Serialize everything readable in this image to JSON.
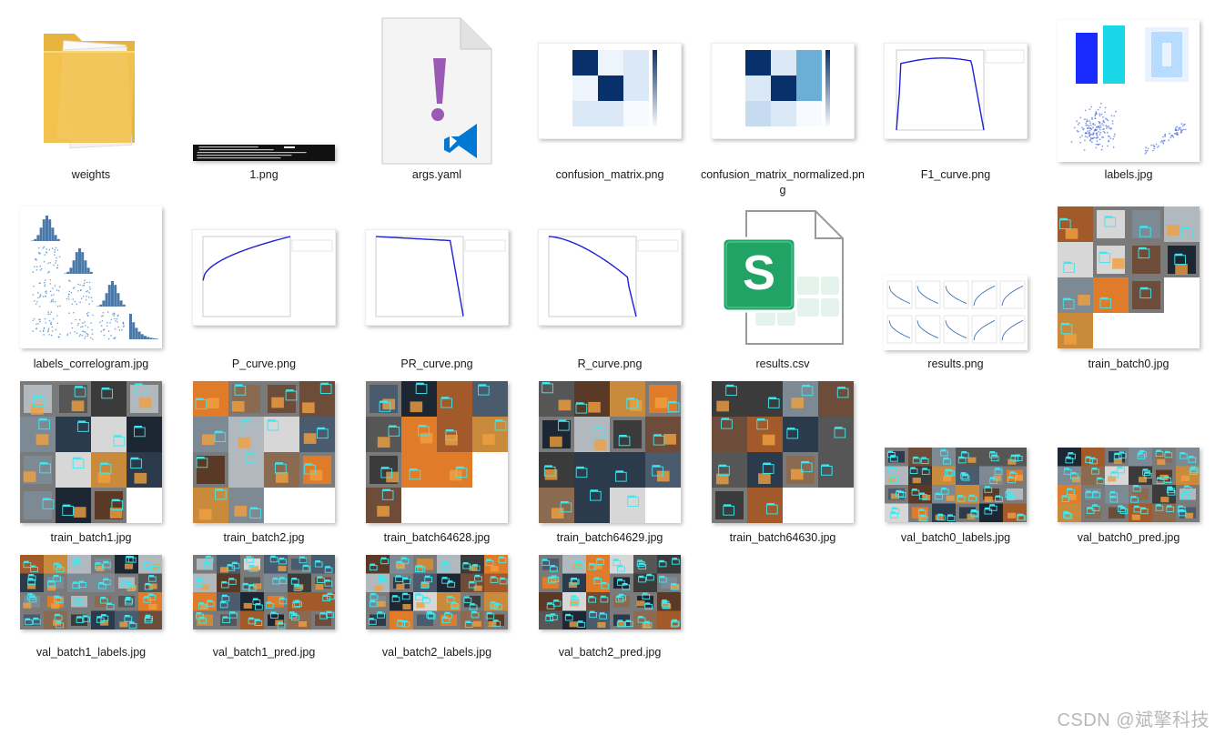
{
  "files": [
    {
      "name": "weights",
      "kind": "folder",
      "icon": "folder-icon"
    },
    {
      "name": "1.png",
      "kind": "terminal",
      "icon": "terminal-screenshot-thumbnail"
    },
    {
      "name": "args.yaml",
      "kind": "yaml",
      "icon": "yaml-file-icon"
    },
    {
      "name": "confusion_matrix.png",
      "kind": "confusion",
      "icon": "confusion-matrix-thumbnail"
    },
    {
      "name": "confusion_matrix_normalized.png",
      "kind": "confusion-norm",
      "icon": "confusion-matrix-thumbnail"
    },
    {
      "name": "F1_curve.png",
      "kind": "f1",
      "icon": "curve-chart-thumbnail"
    },
    {
      "name": "labels.jpg",
      "kind": "labels",
      "icon": "labels-chart-thumbnail"
    },
    {
      "name": "labels_correlogram.jpg",
      "kind": "correlogram",
      "icon": "correlogram-thumbnail"
    },
    {
      "name": "P_curve.png",
      "kind": "p",
      "icon": "curve-chart-thumbnail"
    },
    {
      "name": "PR_curve.png",
      "kind": "pr",
      "icon": "curve-chart-thumbnail"
    },
    {
      "name": "R_curve.png",
      "kind": "r",
      "icon": "curve-chart-thumbnail"
    },
    {
      "name": "results.csv",
      "kind": "csv",
      "icon": "spreadsheet-file-icon"
    },
    {
      "name": "results.png",
      "kind": "results",
      "icon": "results-chart-thumbnail"
    },
    {
      "name": "train_batch0.jpg",
      "kind": "batch-square",
      "icon": "photo-mosaic-thumbnail"
    },
    {
      "name": "train_batch1.jpg",
      "kind": "batch-square",
      "icon": "photo-mosaic-thumbnail"
    },
    {
      "name": "train_batch2.jpg",
      "kind": "batch-square",
      "icon": "photo-mosaic-thumbnail"
    },
    {
      "name": "train_batch64628.jpg",
      "kind": "batch-square",
      "icon": "photo-mosaic-thumbnail"
    },
    {
      "name": "train_batch64629.jpg",
      "kind": "batch-square",
      "icon": "photo-mosaic-thumbnail"
    },
    {
      "name": "train_batch64630.jpg",
      "kind": "batch-square",
      "icon": "photo-mosaic-thumbnail"
    },
    {
      "name": "val_batch0_labels.jpg",
      "kind": "batch-wide",
      "icon": "photo-mosaic-thumbnail"
    },
    {
      "name": "val_batch0_pred.jpg",
      "kind": "batch-wide",
      "icon": "photo-mosaic-thumbnail"
    },
    {
      "name": "val_batch1_labels.jpg",
      "kind": "batch-wide",
      "icon": "photo-mosaic-thumbnail"
    },
    {
      "name": "val_batch1_pred.jpg",
      "kind": "batch-wide",
      "icon": "photo-mosaic-thumbnail"
    },
    {
      "name": "val_batch2_labels.jpg",
      "kind": "batch-wide",
      "icon": "photo-mosaic-thumbnail"
    },
    {
      "name": "val_batch2_pred.jpg",
      "kind": "batch-wide",
      "icon": "photo-mosaic-thumbnail"
    }
  ],
  "watermark": "CSDN @斌擎科技",
  "colors": {
    "folder": "#f3c24f",
    "csv_green": "#21a366",
    "yaml_purple": "#9b59b6",
    "vscode_blue": "#0078d4",
    "curve_blue": "#1f1fd6",
    "heat_dark": "#08306b",
    "mosaic_gray": "#7a7a7a",
    "box_cyan": "#3ee8f0"
  }
}
